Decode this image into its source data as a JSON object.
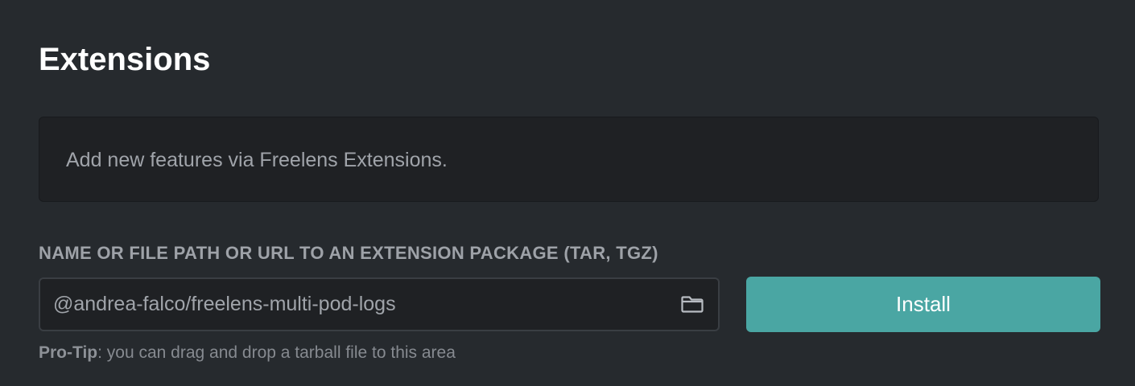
{
  "page": {
    "title": "Extensions"
  },
  "notice": {
    "text": "Add new features via Freelens Extensions."
  },
  "install_form": {
    "label": "NAME OR FILE PATH OR URL TO AN EXTENSION PACKAGE (TAR, TGZ)",
    "input_value": "@andrea-falco/freelens-multi-pod-logs",
    "browse_icon": "folder-icon",
    "install_label": "Install",
    "protip_strong": "Pro-Tip",
    "protip_text": ": you can drag and drop a tarball file to this area"
  },
  "colors": {
    "background": "#262a2e",
    "panel": "#1f2124",
    "accent": "#4aa6a3",
    "muted_text": "#a0a4aa"
  }
}
